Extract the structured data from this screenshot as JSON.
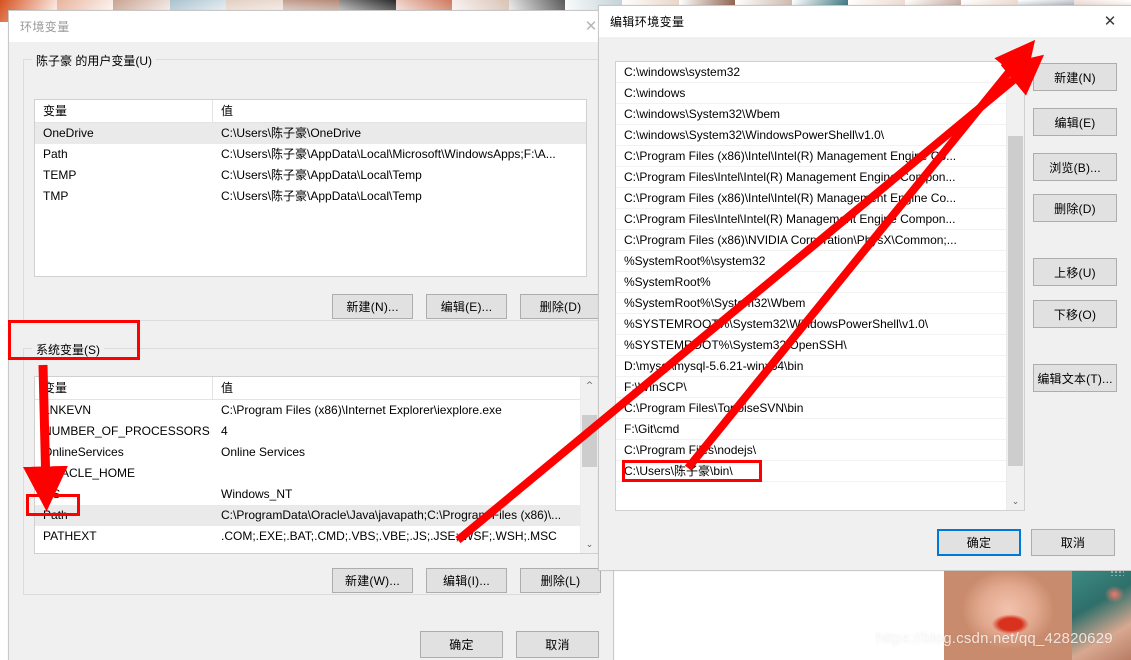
{
  "background": {
    "watermark": "https://blog.csdn.net/qq_42820629",
    "strip_colors": [
      "#d6511f",
      "#e8b49c",
      "#c9a391",
      "#a9c2cf",
      "#e3cfc2",
      "#b58a78",
      "#2a2a2a",
      "#cf7a5e",
      "#d9c3b4",
      "#5a5a5a",
      "#c3d3d8",
      "#e9d6c9",
      "#8c5f4c",
      "#c7b2a4",
      "#1f5f6b",
      "#e6cfc3",
      "#a88575",
      "#d8b9a6",
      "#2d3f52",
      "#c59a86"
    ]
  },
  "env_dialog": {
    "title": "环境变量",
    "close_icon": "close-icon",
    "user_group_legend": "陈子豪 的用户变量(U)",
    "system_group_legend": "系统变量(S)",
    "columns": [
      "变量",
      "值"
    ],
    "user_vars": [
      {
        "name": "OneDrive",
        "value": "C:\\Users\\陈子豪\\OneDrive",
        "selected": true
      },
      {
        "name": "Path",
        "value": "C:\\Users\\陈子豪\\AppData\\Local\\Microsoft\\WindowsApps;F:\\A...",
        "selected": false
      },
      {
        "name": "TEMP",
        "value": "C:\\Users\\陈子豪\\AppData\\Local\\Temp",
        "selected": false
      },
      {
        "name": "TMP",
        "value": "C:\\Users\\陈子豪\\AppData\\Local\\Temp",
        "selected": false
      }
    ],
    "user_buttons": [
      {
        "label": "新建(N)...",
        "name": "user-new-button"
      },
      {
        "label": "编辑(E)...",
        "name": "user-edit-button"
      },
      {
        "label": "删除(D)",
        "name": "user-delete-button"
      }
    ],
    "system_vars": [
      {
        "name": "LNKEVN",
        "value": "C:\\Program Files (x86)\\Internet Explorer\\iexplore.exe",
        "selected": false
      },
      {
        "name": "NUMBER_OF_PROCESSORS",
        "value": "4",
        "selected": false
      },
      {
        "name": "OnlineServices",
        "value": "Online Services",
        "selected": false
      },
      {
        "name": "ORACLE_HOME",
        "value": "",
        "selected": false
      },
      {
        "name": "OS",
        "value": "Windows_NT",
        "selected": false
      },
      {
        "name": "Path",
        "value": "C:\\ProgramData\\Oracle\\Java\\javapath;C:\\Program Files (x86)\\...",
        "selected": true
      },
      {
        "name": "PATHEXT",
        "value": ".COM;.EXE;.BAT;.CMD;.VBS;.VBE;.JS;.JSE;.WSF;.WSH;.MSC",
        "selected": false
      }
    ],
    "system_buttons": [
      {
        "label": "新建(W)...",
        "name": "system-new-button"
      },
      {
        "label": "编辑(I)...",
        "name": "system-edit-button"
      },
      {
        "label": "删除(L)",
        "name": "system-delete-button"
      }
    ],
    "ok_label": "确定",
    "cancel_label": "取消"
  },
  "edit_dialog": {
    "title": "编辑环境变量",
    "close_icon": "close-icon",
    "entries": [
      "C:\\windows\\system32",
      "C:\\windows",
      "C:\\windows\\System32\\Wbem",
      "C:\\windows\\System32\\WindowsPowerShell\\v1.0\\",
      "C:\\Program Files (x86)\\Intel\\Intel(R) Management Engine Co...",
      "C:\\Program Files\\Intel\\Intel(R) Management Engine Compon...",
      "C:\\Program Files (x86)\\Intel\\Intel(R) Management Engine Co...",
      "C:\\Program Files\\Intel\\Intel(R) Management Engine Compon...",
      "C:\\Program Files (x86)\\NVIDIA Corporation\\PhysX\\Common;...",
      "%SystemRoot%\\system32",
      "%SystemRoot%",
      "%SystemRoot%\\System32\\Wbem",
      "%SYSTEMROOT%\\System32\\WindowsPowerShell\\v1.0\\",
      "%SYSTEMROOT%\\System32\\OpenSSH\\",
      "D:\\mysql\\mysql-5.6.21-winx64\\bin",
      "F:\\WinSCP\\",
      "C:\\Program Files\\TortoiseSVN\\bin",
      "F:\\Git\\cmd",
      "C:\\Program Files\\nodejs\\",
      "C:\\Users\\陈子豪\\bin\\"
    ],
    "side_buttons": [
      {
        "label": "新建(N)",
        "name": "edit-new-button"
      },
      {
        "label": "编辑(E)",
        "name": "edit-edit-button"
      },
      {
        "label": "浏览(B)...",
        "name": "edit-browse-button"
      },
      {
        "label": "删除(D)",
        "name": "edit-delete-button"
      },
      {
        "label": "上移(U)",
        "name": "edit-move-up-button"
      },
      {
        "label": "下移(O)",
        "name": "edit-move-down-button"
      },
      {
        "label": "编辑文本(T)...",
        "name": "edit-text-button"
      }
    ],
    "ok_label": "确定",
    "cancel_label": "取消"
  },
  "annotations": {
    "accent_color": "#ff0000",
    "boxes": [
      {
        "name": "system-variables-label-highlight"
      },
      {
        "name": "system-path-row-highlight"
      },
      {
        "name": "user-bin-entry-highlight"
      }
    ],
    "arrows": [
      {
        "name": "arrow-to-path-row"
      },
      {
        "name": "arrow-to-new-button"
      },
      {
        "name": "arrow-to-edit-button"
      }
    ]
  }
}
